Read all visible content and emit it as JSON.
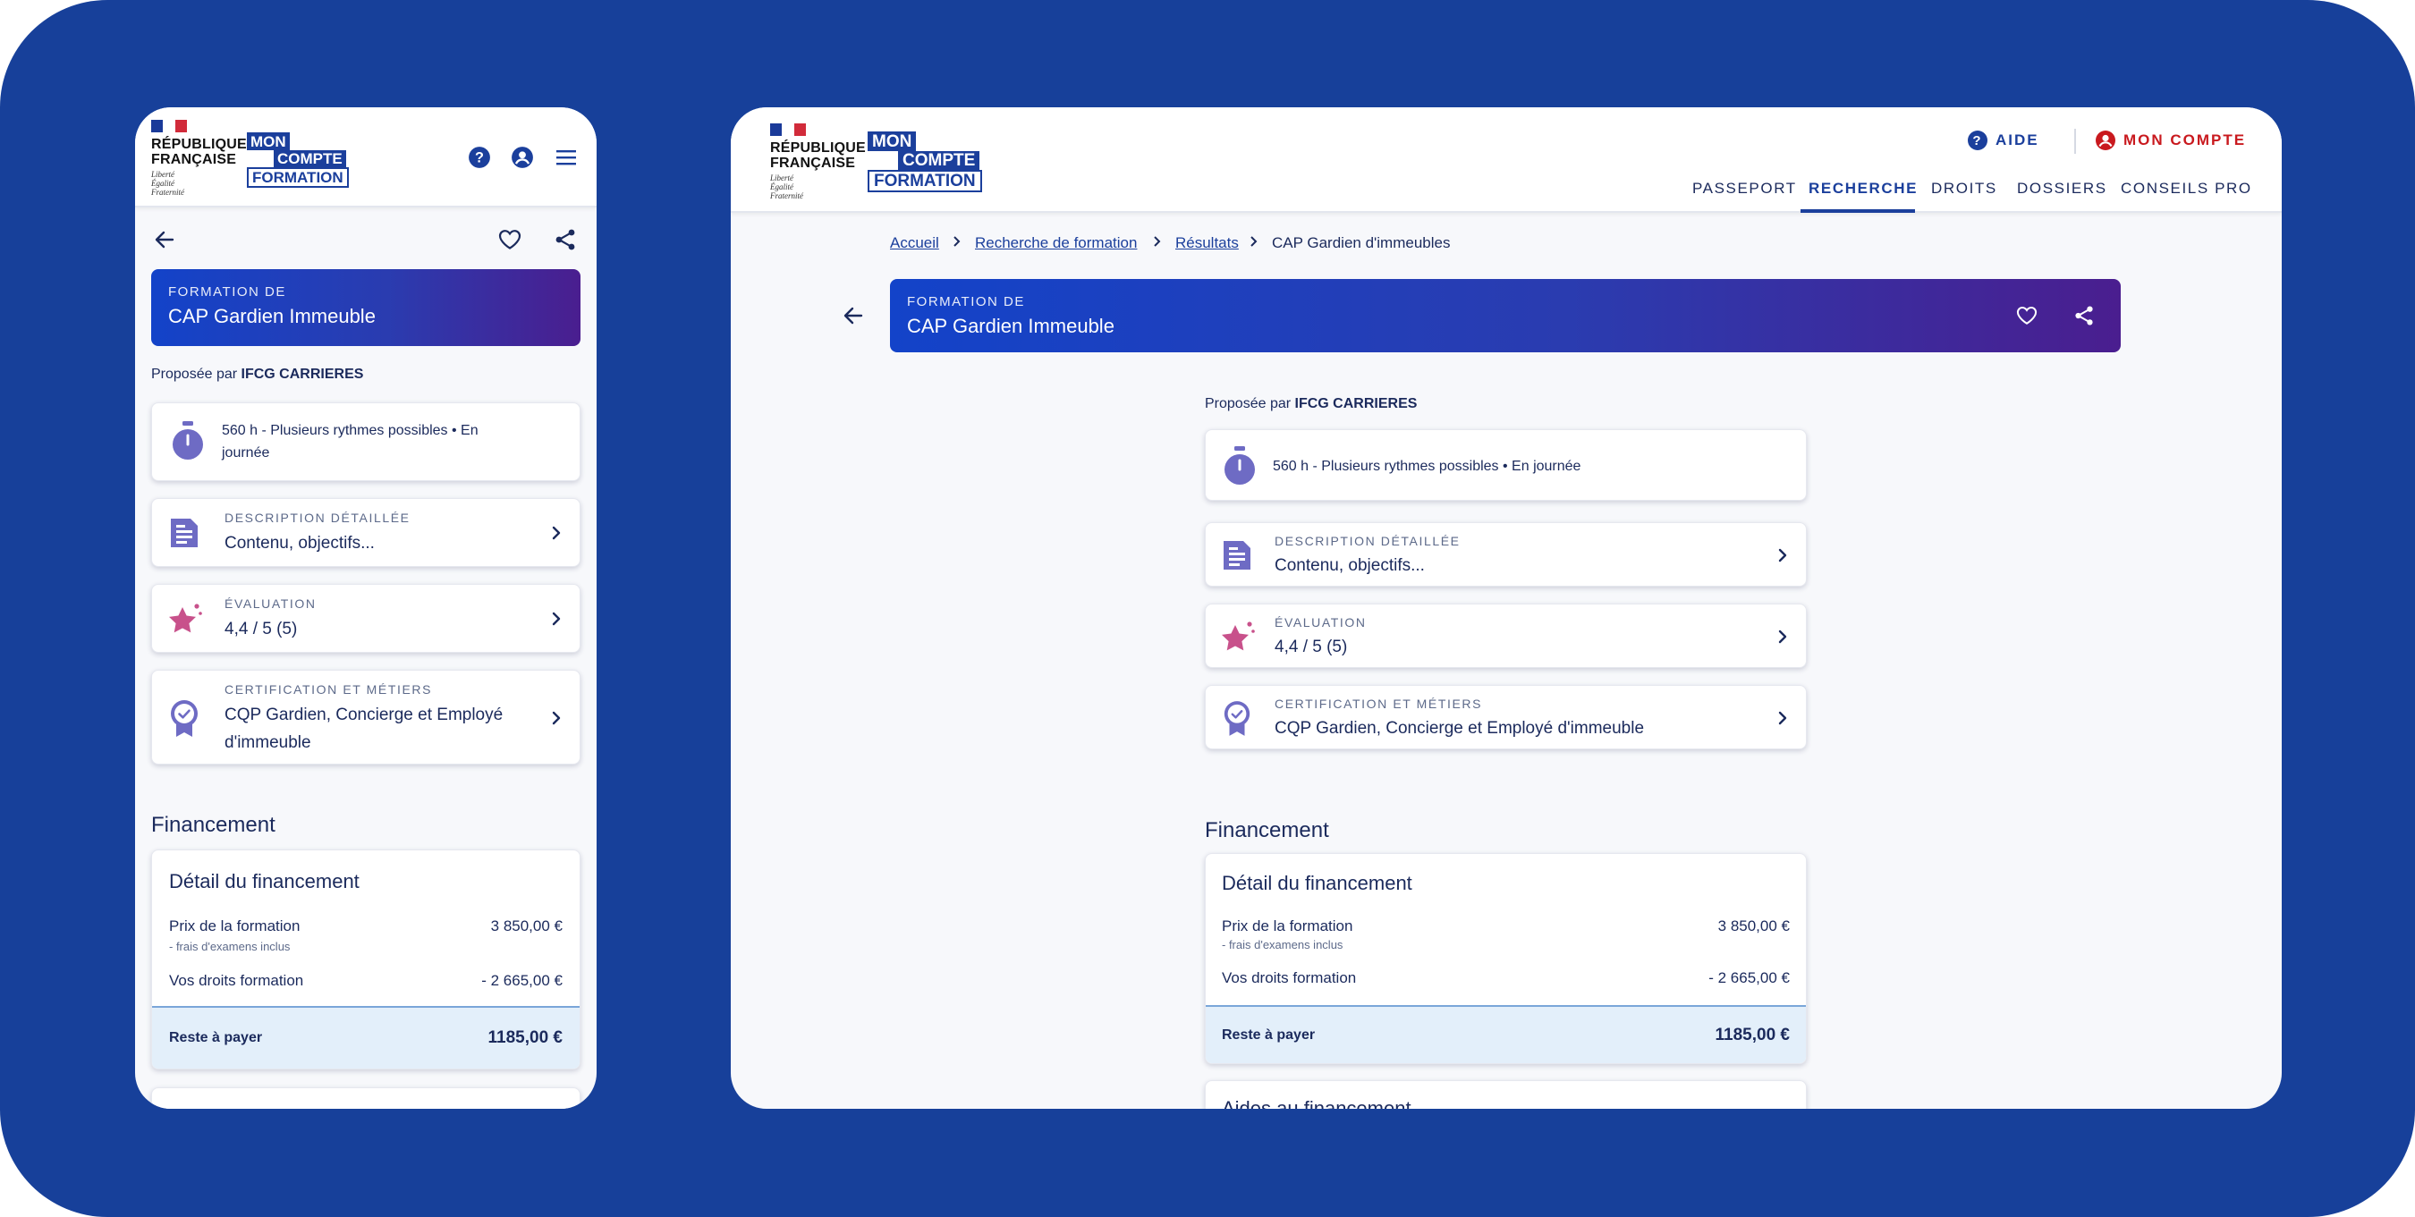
{
  "brand": {
    "rf_line1": "RÉPUBLIQUE",
    "rf_line2": "FRANÇAISE",
    "devise": [
      "Liberté",
      "Égalité",
      "Fraternité"
    ],
    "mcf_line1": "MON",
    "mcf_line2": "COMPTE",
    "mcf_line3": "FORMATION"
  },
  "desktop_header": {
    "aide": "AIDE",
    "compte": "MON COMPTE",
    "nav": [
      "PASSEPORT",
      "RECHERCHE",
      "DROITS",
      "DOSSIERS",
      "CONSEILS PRO"
    ],
    "active_nav": "RECHERCHE"
  },
  "breadcrumb": [
    "Accueil",
    "Recherche de formation",
    "Résultats",
    "CAP Gardien d'immeubles"
  ],
  "formation": {
    "banner_label": "FORMATION DE",
    "title": "CAP Gardien Immeuble",
    "proposee_par": "Proposée par",
    "organisme": "IFCG CARRIERES",
    "duree": "560 h - Plusieurs rythmes possibles • En journée",
    "duree_mobile_line1": "560 h - Plusieurs rythmes possibles • En",
    "duree_mobile_line2": "journée",
    "description_label": "DESCRIPTION DÉTAILLÉE",
    "description_value": "Contenu, objectifs...",
    "evaluation_label": "ÉVALUATION",
    "evaluation_value": "4,4 / 5 (5)",
    "certification_label": "CERTIFICATION ET MÉTIERS",
    "certification_value": "CQP Gardien, Concierge et Employé d'immeuble",
    "certification_mobile_line1": "CQP Gardien, Concierge et Employé",
    "certification_mobile_line2": "d'immeuble"
  },
  "financement": {
    "section_title": "Financement",
    "card_title": "Détail du financement",
    "prix_label": "Prix de la formation",
    "prix_note": "- frais d'examens inclus",
    "prix_value": "3 850,00 €",
    "droits_label": "Vos droits formation",
    "droits_value": "- 2 665,00 €",
    "reste_label": "Reste à payer",
    "reste_value": "1185,00 €",
    "aides_title": "Aides au financement"
  },
  "colors": {
    "background": "#17409a",
    "brand_blue": "#1b3f9c",
    "accent_red": "#c9191e",
    "icon_violet": "#6e6bc4",
    "star_pink": "#c8518b"
  },
  "icons": [
    "help-icon",
    "account-icon",
    "menu-icon",
    "back-arrow-icon",
    "heart-icon",
    "share-icon",
    "timer-icon",
    "document-icon",
    "star-icon",
    "badge-icon",
    "chevron-right-icon"
  ]
}
